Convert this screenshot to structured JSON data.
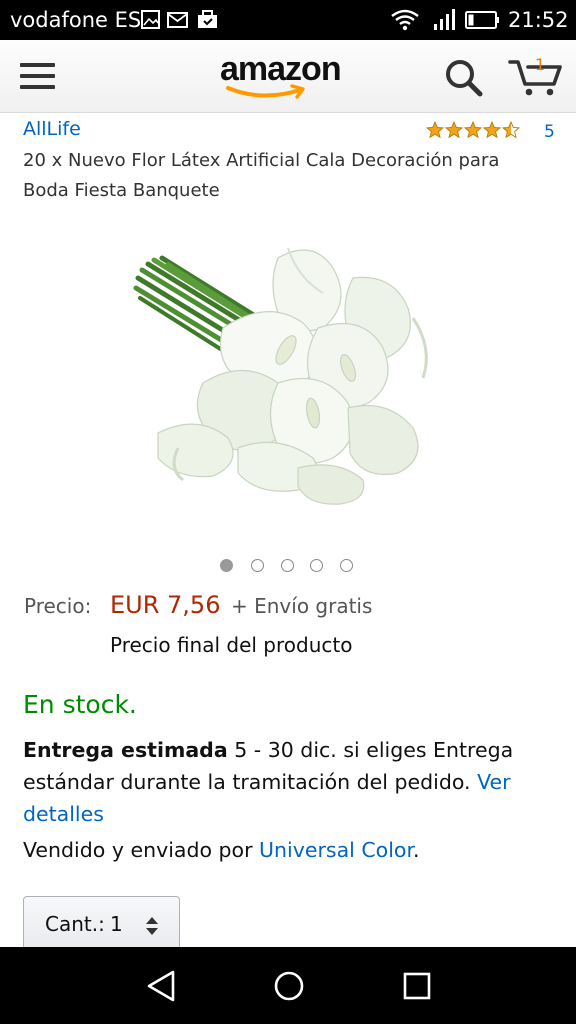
{
  "status_bar": {
    "carrier": "vodafone ES",
    "time": "21:52",
    "icons": [
      "image-icon",
      "mail-icon",
      "briefcase-icon",
      "wifi-icon",
      "signal-icon",
      "battery-icon"
    ]
  },
  "header": {
    "logo_text": "amazon",
    "cart_count": "1",
    "icons": [
      "menu-icon",
      "search-icon",
      "cart-icon"
    ]
  },
  "product": {
    "brand": "AllLife",
    "rating": 4.5,
    "rating_max": 5,
    "review_count": "5",
    "title": "20 x Nuevo Flor Látex Artificial Cala Decoración para Boda Fiesta Banquete",
    "image_alt": "ramo de calas blancas",
    "image_count": 5,
    "active_image": 1
  },
  "price": {
    "label": "Precio:",
    "value": "EUR 7,56",
    "shipping": "+ Envío gratis",
    "final_note": "Precio final del producto"
  },
  "availability": {
    "stock": "En stock.",
    "delivery_label": "Entrega estimada",
    "delivery_text": "5 - 30 dic. si eliges Entrega estándar durante la tramitación del pedido.",
    "details_link": "Ver detalles",
    "seller_prefix": "Vendido y enviado por",
    "seller_name": "Universal Color",
    "seller_suffix": "."
  },
  "quantity": {
    "label": "Cant.:",
    "value": "1"
  },
  "colors": {
    "link": "#0066c0",
    "price": "#b12704",
    "stock": "#008a00",
    "star": "#f0a41c",
    "cart_count": "#e47911"
  }
}
